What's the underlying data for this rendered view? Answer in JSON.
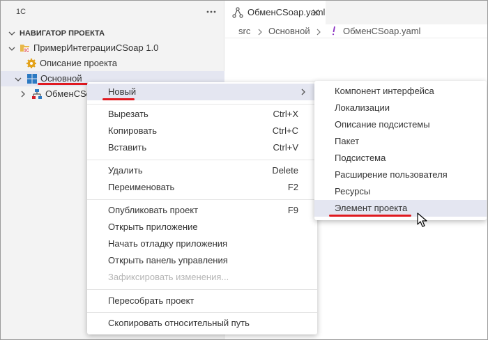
{
  "sidebar": {
    "title": "1С",
    "more_icon": "ellipsis-icon",
    "section_title": "НАВИГАТОР ПРОЕКТА",
    "tree": {
      "project": "ПримерИнтеграцииCSoap 1.0",
      "project_description": "Описание проекта",
      "subsystem": "Основной",
      "child": "ОбменCSoap"
    }
  },
  "editor": {
    "tab_label": "ОбменCSoap.yaml",
    "breadcrumb": [
      "src",
      "Основной",
      "ОбменCSoap.yaml"
    ]
  },
  "context_menu": {
    "groups": [
      [
        {
          "label": "Новый",
          "shortcut": ""
        }
      ],
      [
        {
          "label": "Вырезать",
          "shortcut": "Ctrl+X"
        },
        {
          "label": "Копировать",
          "shortcut": "Ctrl+C"
        },
        {
          "label": "Вставить",
          "shortcut": "Ctrl+V"
        }
      ],
      [
        {
          "label": "Удалить",
          "shortcut": "Delete"
        },
        {
          "label": "Переименовать",
          "shortcut": "F2"
        }
      ],
      [
        {
          "label": "Опубликовать проект",
          "shortcut": "F9"
        },
        {
          "label": "Открыть приложение",
          "shortcut": ""
        },
        {
          "label": "Начать отладку приложения",
          "shortcut": ""
        },
        {
          "label": "Открыть панель управления",
          "shortcut": ""
        },
        {
          "label": "Зафиксировать изменения...",
          "shortcut": ""
        }
      ],
      [
        {
          "label": "Пересобрать проект",
          "shortcut": ""
        }
      ],
      [
        {
          "label": "Скопировать относительный путь",
          "shortcut": ""
        }
      ]
    ]
  },
  "submenu": {
    "items": [
      "Компонент интерфейса",
      "Локализации",
      "Описание подсистемы",
      "Пакет",
      "Подсистема",
      "Расширение пользователя",
      "Ресурсы",
      "Элемент проекта"
    ]
  },
  "colors": {
    "highlight": "#e4e6f1",
    "annotation_red": "#e0191f",
    "disabled_text": "#b5b5b5"
  }
}
